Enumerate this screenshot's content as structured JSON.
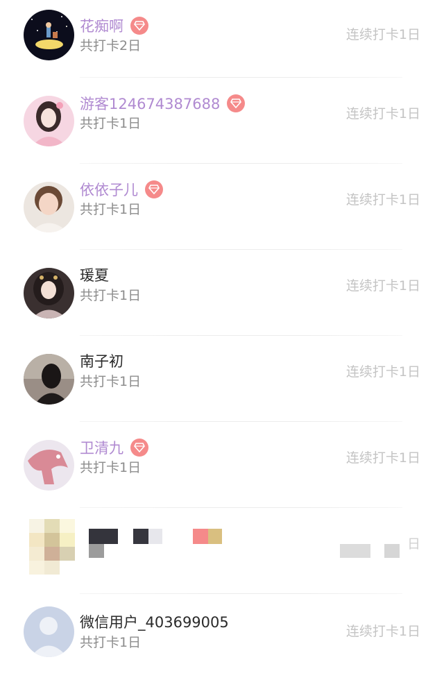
{
  "entries": [
    {
      "name": "花痴啊",
      "vip": true,
      "total": "共打卡2日",
      "streak": "连续打卡1日",
      "avatar": "night-scene-avatar"
    },
    {
      "name": "游客124674387688",
      "vip": true,
      "total": "共打卡1日",
      "streak": "连续打卡1日",
      "avatar": "costume-girl-avatar"
    },
    {
      "name": "依依子儿",
      "vip": true,
      "total": "共打卡1日",
      "streak": "连续打卡1日",
      "avatar": "child-photo-avatar"
    },
    {
      "name": "瑗夏",
      "vip": false,
      "total": "共打卡1日",
      "streak": "连续打卡1日",
      "avatar": "illustrated-girl-avatar"
    },
    {
      "name": "南子初",
      "vip": false,
      "total": "共打卡1日",
      "streak": "连续打卡1日",
      "avatar": "dark-hair-photo-avatar"
    },
    {
      "name": "卫清九",
      "vip": true,
      "total": "共打卡1日",
      "streak": "连续打卡1日",
      "avatar": "pink-cartoon-avatar"
    },
    {
      "pixelated": true,
      "streak_fragment": "日",
      "avatar": "pixelated-avatar"
    },
    {
      "name": "微信用户_403699005",
      "vip": false,
      "total": "共打卡1日",
      "streak": "连续打卡1日",
      "avatar": "default-user-avatar"
    }
  ],
  "colors": {
    "vip_name": "#b08ad1",
    "plain_name": "#2a2a2a",
    "vip_badge": "#f58a8a",
    "total_text": "#8c8c8c",
    "streak_text": "#c4c4c4"
  },
  "icons": {
    "vip_badge": "diamond-icon"
  }
}
